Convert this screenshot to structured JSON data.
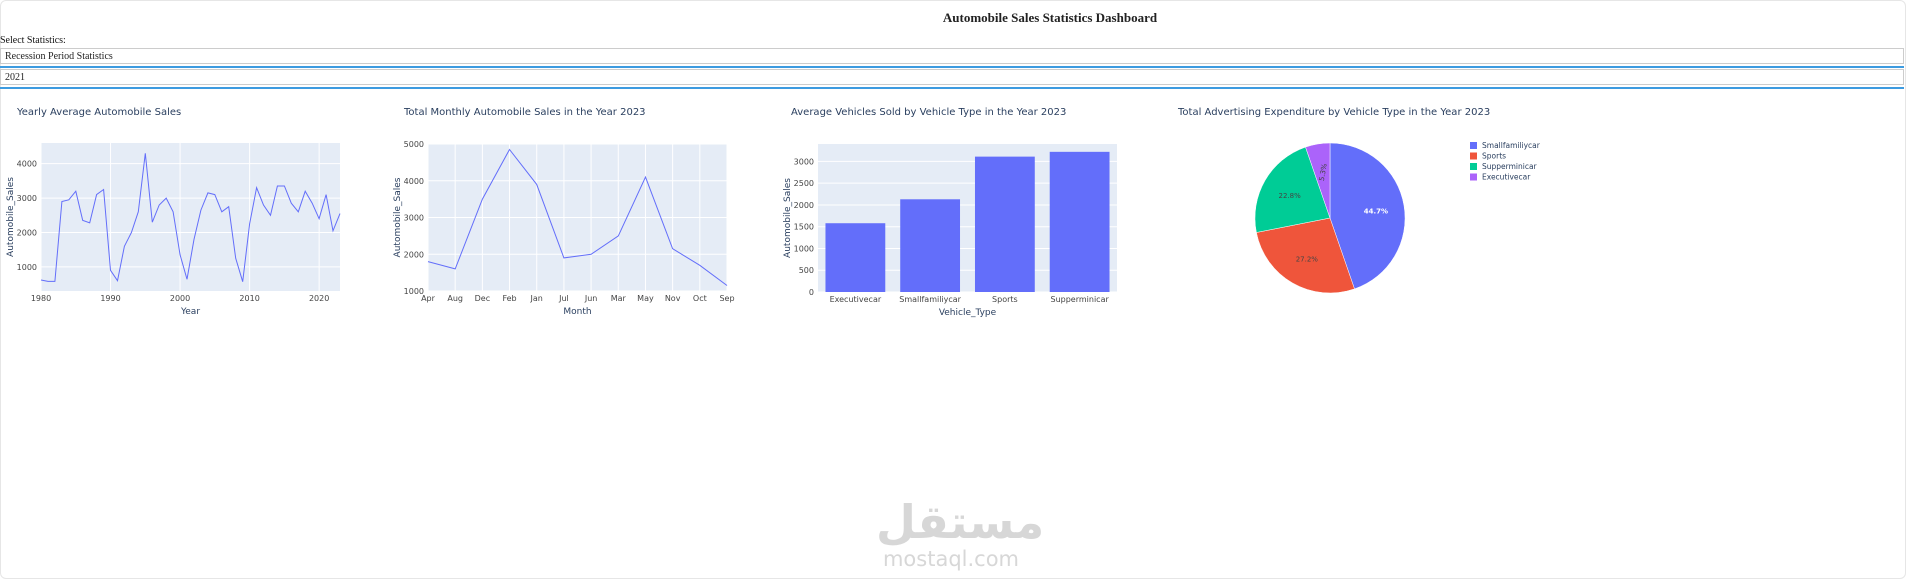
{
  "page": {
    "title": "Automobile Sales Statistics Dashboard",
    "select_label": "Select Statistics:",
    "dropdown_statistics": "Recession Period Statistics",
    "dropdown_year": "2021"
  },
  "colors": {
    "accent": "#636efa",
    "plot_bg": "#e5ecf6",
    "rule": "#3d9be0"
  },
  "chart_data": [
    {
      "type": "line",
      "title": "Yearly Average Automobile Sales",
      "xlabel": "Year",
      "ylabel": "Automobile_Sales",
      "xlim": [
        1980,
        2023
      ],
      "ylim": [
        300,
        4600
      ],
      "xticks": [
        1980,
        1990,
        2000,
        2010,
        2020
      ],
      "yticks": [
        1000,
        2000,
        3000,
        4000
      ],
      "x": [
        1980,
        1981,
        1982,
        1983,
        1984,
        1985,
        1986,
        1987,
        1988,
        1989,
        1990,
        1991,
        1992,
        1993,
        1994,
        1995,
        1996,
        1997,
        1998,
        1999,
        2000,
        2001,
        2002,
        2003,
        2004,
        2005,
        2006,
        2007,
        2008,
        2009,
        2010,
        2011,
        2012,
        2013,
        2014,
        2015,
        2016,
        2017,
        2018,
        2019,
        2020,
        2021,
        2022,
        2023
      ],
      "y": [
        620,
        580,
        580,
        2900,
        2950,
        3200,
        2350,
        2280,
        3100,
        3250,
        900,
        600,
        1600,
        2000,
        2600,
        4300,
        2300,
        2800,
        3000,
        2600,
        1350,
        640,
        1800,
        2650,
        3150,
        3100,
        2600,
        2750,
        1250,
        570,
        2250,
        3300,
        2800,
        2500,
        3350,
        3350,
        2850,
        2600,
        3200,
        2850,
        2400,
        3100,
        2050,
        2550
      ]
    },
    {
      "type": "line",
      "title": "Total Monthly Automobile Sales in the Year 2023",
      "xlabel": "Month",
      "ylabel": "Automobile_Sales",
      "categories": [
        "Apr",
        "Aug",
        "Dec",
        "Feb",
        "Jan",
        "Jul",
        "Jun",
        "Mar",
        "May",
        "Nov",
        "Oct",
        "Sep"
      ],
      "ylim": [
        1000,
        5000
      ],
      "yticks": [
        1000,
        2000,
        3000,
        4000,
        5000
      ],
      "values": [
        1800,
        1600,
        3500,
        4850,
        3900,
        1900,
        2000,
        2500,
        4100,
        2150,
        1700,
        1150
      ]
    },
    {
      "type": "bar",
      "title": "Average Vehicles Sold by Vehicle Type in the Year 2023",
      "xlabel": "Vehicle_Type",
      "ylabel": "Automobile_Sales",
      "categories": [
        "Executivecar",
        "Smallfamiliycar",
        "Sports",
        "Supperminicar"
      ],
      "values": [
        1580,
        2130,
        3110,
        3220
      ],
      "ylim": [
        0,
        3400
      ],
      "yticks": [
        0,
        500,
        1000,
        1500,
        2000,
        2500,
        3000
      ]
    },
    {
      "type": "pie",
      "title": "Total Advertising Expenditure by Vehicle Type in the Year 2023",
      "labels": [
        "Smallfamiliycar",
        "Sports",
        "Supperminicar",
        "Executivecar"
      ],
      "values": [
        44.7,
        27.2,
        22.8,
        5.3
      ],
      "value_labels": [
        "44.7%",
        "27.2%",
        "22.8%",
        "5.3%"
      ],
      "colors": [
        "#636efa",
        "#ef553b",
        "#00cc96",
        "#ab63fa"
      ]
    }
  ],
  "watermark": {
    "logo": "مستقل",
    "url": "mostaql.com"
  }
}
